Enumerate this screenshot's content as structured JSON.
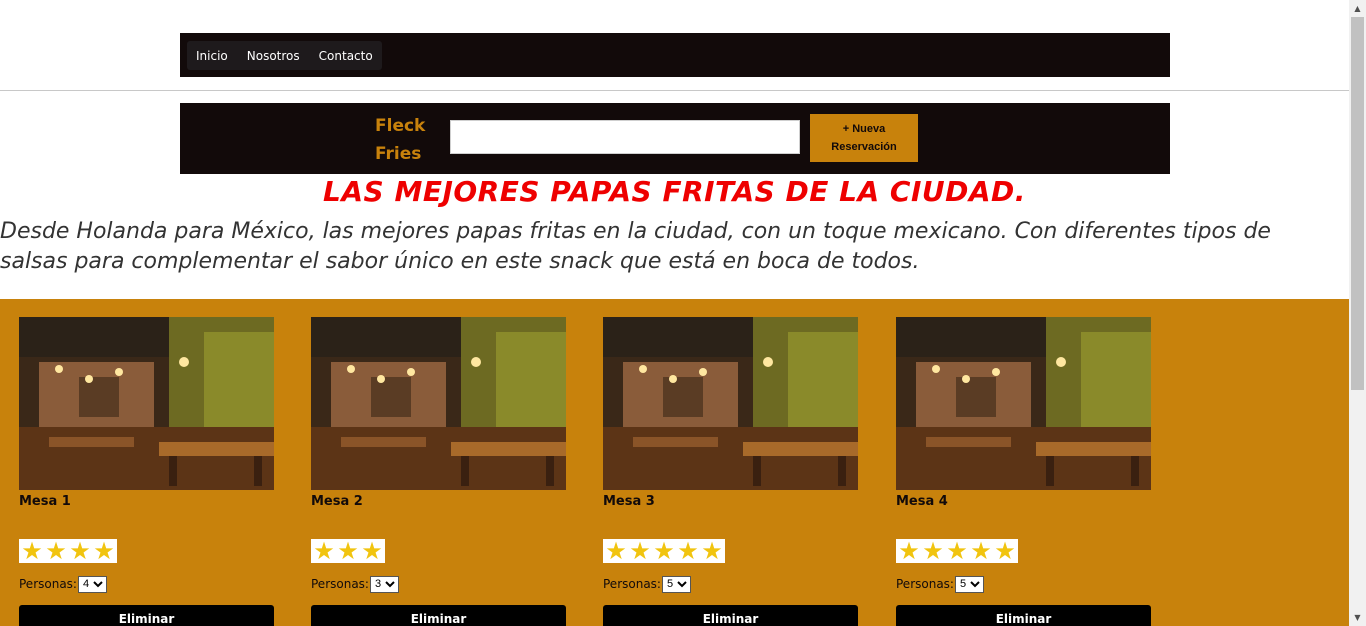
{
  "nav": {
    "links": [
      "Inicio",
      "Nosotros",
      "Contacto"
    ]
  },
  "brand": {
    "name": "Fleck Fries",
    "search_value": "",
    "new_button": "+ Nueva Reservación"
  },
  "hero": {
    "headline": "LAS MEJORES PAPAS FRITAS DE LA CIUDAD.",
    "intro": "Desde Holanda para México, las mejores papas fritas en la ciudad, con un toque mexicano. Con diferentes tipos de salsas para complementar el sabor único en este snack que está en boca de todos."
  },
  "tables": [
    {
      "name": "Mesa 1",
      "stars": 4,
      "people_label": "Personas:",
      "people": "4",
      "delete_label": "Eliminar"
    },
    {
      "name": "Mesa 2",
      "stars": 3,
      "people_label": "Personas:",
      "people": "3",
      "delete_label": "Eliminar"
    },
    {
      "name": "Mesa 3",
      "stars": 5,
      "people_label": "Personas:",
      "people": "5",
      "delete_label": "Eliminar"
    },
    {
      "name": "Mesa 4",
      "stars": 5,
      "people_label": "Personas:",
      "people": "5",
      "delete_label": "Eliminar"
    }
  ],
  "colors": {
    "accent": "#c8820c",
    "dark": "#120a0a",
    "headline": "#ee0000",
    "star": "#f1c40f"
  },
  "icons": {
    "star": "star-icon",
    "photo": "restaurant-photo"
  }
}
